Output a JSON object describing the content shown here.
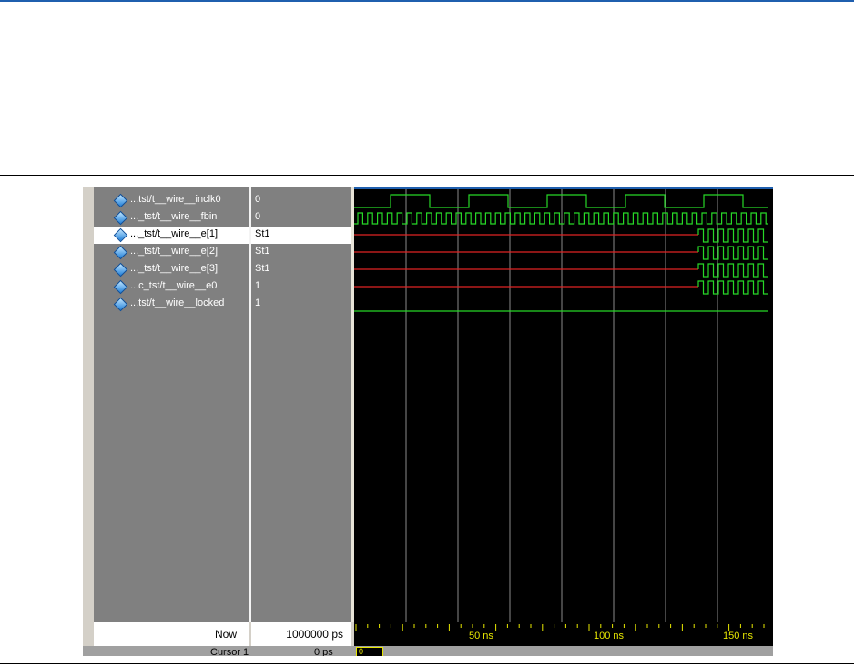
{
  "signals": [
    {
      "name": "...tst/t__wire__inclk0",
      "value": "0"
    },
    {
      "name": "..._tst/t__wire__fbin",
      "value": "0"
    },
    {
      "name": "..._tst/t__wire__e[1]",
      "value": "St1"
    },
    {
      "name": "..._tst/t__wire__e[2]",
      "value": "St1"
    },
    {
      "name": "..._tst/t__wire__e[3]",
      "value": "St1"
    },
    {
      "name": "...c_tst/t__wire__e0",
      "value": "1"
    },
    {
      "name": "...tst/t__wire__locked",
      "value": "1"
    }
  ],
  "footer": {
    "now_label": "Now",
    "now_value": "1000000 ps",
    "cursor_label": "Cursor 1",
    "cursor_value": "0 ps",
    "cursor_marker": "0"
  },
  "timescale": {
    "labels": [
      "50 ns",
      "100 ns",
      "150 ns"
    ]
  },
  "colors": {
    "wave_green": "#27d827",
    "wave_red": "#e02424",
    "grid": "#8a8a8a",
    "tick_yellow": "#e8e800"
  }
}
